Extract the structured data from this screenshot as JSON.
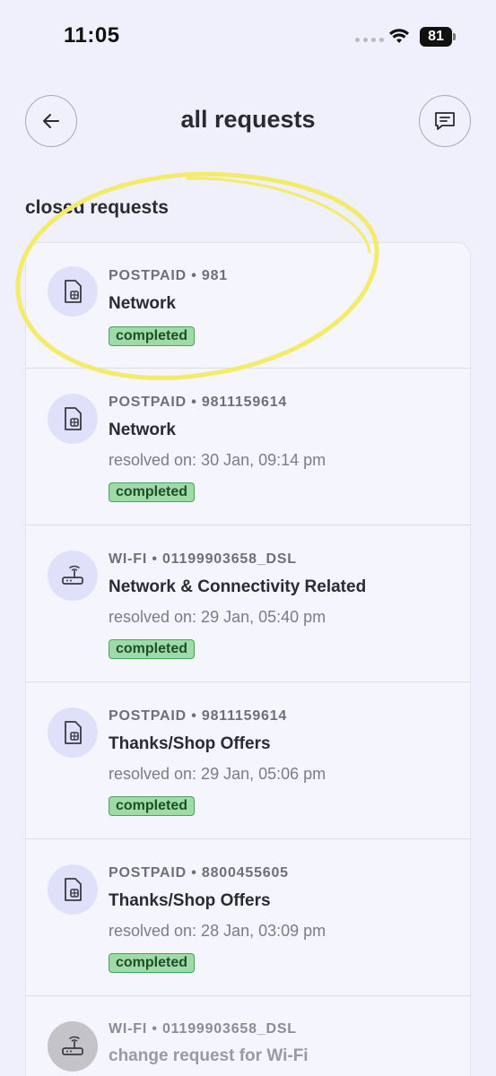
{
  "status_bar": {
    "time": "11:05",
    "battery": "81"
  },
  "header": {
    "title": "all requests"
  },
  "section": {
    "title": "closed requests"
  },
  "requests": [
    {
      "meta": "POSTPAID • 981",
      "title": "Network",
      "resolved": "",
      "status": "completed",
      "icon": "sim-card-icon"
    },
    {
      "meta": "POSTPAID • 9811159614",
      "title": "Network",
      "resolved": "resolved on: 30 Jan, 09:14 pm",
      "status": "completed",
      "icon": "sim-card-icon"
    },
    {
      "meta": "WI-FI • 01199903658_DSL",
      "title": "Network & Connectivity Related",
      "resolved": "resolved on: 29 Jan, 05:40 pm",
      "status": "completed",
      "icon": "router-icon"
    },
    {
      "meta": "POSTPAID • 9811159614",
      "title": "Thanks/Shop Offers",
      "resolved": "resolved on: 29 Jan, 05:06 pm",
      "status": "completed",
      "icon": "sim-card-icon"
    },
    {
      "meta": "POSTPAID • 8800455605",
      "title": "Thanks/Shop Offers",
      "resolved": "resolved on: 28 Jan, 03:09 pm",
      "status": "completed",
      "icon": "sim-card-icon"
    },
    {
      "meta": "WI-FI • 01199903658_DSL",
      "title": "change request for Wi-Fi",
      "resolved": "",
      "status": "",
      "icon": "router-icon"
    }
  ],
  "colors": {
    "background": "#eff0fb",
    "badge_bg": "#9fdba8",
    "badge_border": "#4aa35a",
    "highlight": "#f2ec6a"
  }
}
